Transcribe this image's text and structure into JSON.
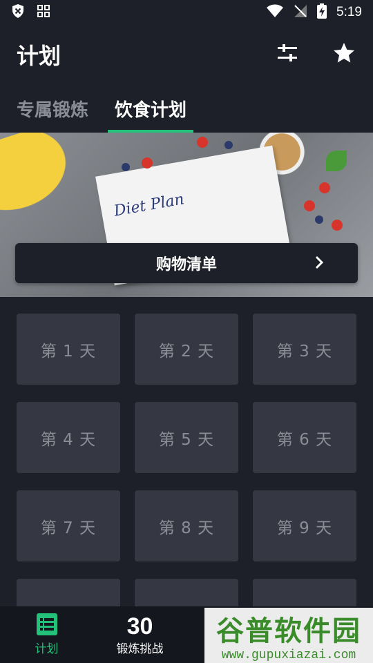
{
  "status": {
    "time": "5:19"
  },
  "header": {
    "title": "计划"
  },
  "tabs": [
    {
      "label": "专属锻炼",
      "active": false
    },
    {
      "label": "饮食计划",
      "active": true
    }
  ],
  "hero": {
    "handwriting": "Diet Plan"
  },
  "shopping": {
    "label": "购物清单"
  },
  "days": [
    "第 1 天",
    "第 2 天",
    "第 3 天",
    "第 4 天",
    "第 5 天",
    "第 6 天",
    "第 7 天",
    "第 8 天",
    "第 9 天",
    "",
    "",
    ""
  ],
  "bottom_nav": [
    {
      "label": "计划",
      "icon": "list-icon",
      "active": true
    },
    {
      "label": "锻炼挑战",
      "big": "30",
      "active": false
    }
  ],
  "watermark": {
    "line1": "谷普软件园",
    "line2": "www.gupuxiazai.com"
  },
  "colors": {
    "accent": "#23c17a",
    "background": "#1d2029",
    "card": "#353842"
  }
}
